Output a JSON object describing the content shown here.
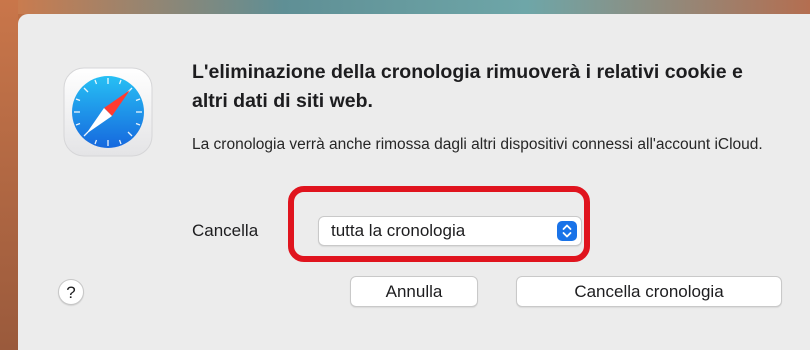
{
  "dialog": {
    "app_icon": "safari-compass-icon",
    "title": "L'eliminazione della cronologia rimuoverà i relativi cookie e altri dati di siti web.",
    "message": "La cronologia verrà anche rimossa dagli altri dispositivi connessi all'account iCloud.",
    "clear_label": "Cancella",
    "clear_range": {
      "selected": "tutta la cronologia",
      "icon": "chevron-up-down-icon"
    },
    "help_label": "?",
    "cancel_label": "Annulla",
    "confirm_label": "Cancella cronologia"
  },
  "colors": {
    "dialog_background": "#ececec",
    "annotation_highlight": "#e0141e",
    "accent": "#1a73e8"
  }
}
